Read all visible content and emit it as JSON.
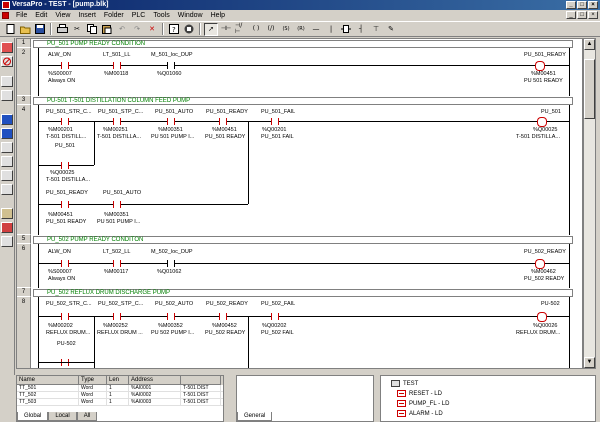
{
  "window": {
    "title": "VersaPro - TEST - [pump.blk]"
  },
  "menu": {
    "items": [
      "File",
      "Edit",
      "View",
      "Insert",
      "Folder",
      "PLC",
      "Tools",
      "Window",
      "Help"
    ]
  },
  "toolbar": {
    "buttons": [
      "new-icon",
      "open-icon",
      "save-icon",
      "print-icon",
      "cut-icon",
      "copy-icon",
      "paste-icon",
      "undo-icon",
      "redo-icon",
      "delete-icon",
      "help-icon",
      "stop-icon",
      "pointer-icon",
      "contact-no-icon",
      "contact-nc-icon",
      "coil-icon",
      "coil-neg-icon",
      "set-coil-icon",
      "reset-coil-icon",
      "horizontal-wire-icon",
      "vertical-wire-icon",
      "function-block-icon",
      "branch-icon",
      "rung-icon",
      "comment-icon"
    ],
    "glyphs": {
      "contact_no": "-| |-",
      "contact_nc": "-|/|-",
      "coil": "( )",
      "coil_neg": "(/)",
      "set": "(S)",
      "reset": "(R)"
    }
  },
  "rungs": [
    {
      "num": "1",
      "comment": "PU_501 PUMP READY CONDITION"
    },
    {
      "num": "2",
      "contacts": [
        {
          "name": "ALW_ON",
          "addr": "%S00007",
          "desc": "Always ON"
        },
        {
          "name": "LT_501_LL",
          "addr": "%M00118",
          "desc": ""
        },
        {
          "name": "M_501_loc_DUP",
          "addr": "%Q01060",
          "desc": ""
        }
      ],
      "coil": {
        "name": "PU_501_READY",
        "addr": "%M00451",
        "desc": "PU 501 READY"
      }
    },
    {
      "num": "3",
      "comment": "PU-501 T-501 DISTILLATION COLUMN FEED PUMP"
    },
    {
      "num": "4",
      "contacts": [
        {
          "name": "PU_501_STR_C...",
          "addr": "%M00201",
          "desc": "T-501 DISTILL..."
        },
        {
          "name": "PU_501_STP_C...",
          "addr": "%M00251",
          "desc": "T-501 DISTILLA..."
        },
        {
          "name": "PU_501_AUTO",
          "addr": "%M00351",
          "desc": "PU 501 PUMP I..."
        },
        {
          "name": "PU_501_READY",
          "addr": "%M00451",
          "desc": "PU_501 READY"
        },
        {
          "name": "PU_501_FAIL",
          "addr": "%Q00201",
          "desc": "PU_501 FAIL"
        }
      ],
      "branch": [
        {
          "name": "PU_501",
          "addr": "%Q00025",
          "desc": "T-501 DISTILLA..."
        },
        {
          "name": "PU_501_READY",
          "addr": "%M00451",
          "desc": "PU_501 READY"
        },
        {
          "name": "PU_501_AUTO",
          "addr": "%M00351",
          "desc": "PU 501 PUMP I..."
        }
      ],
      "coil": {
        "name": "PU_501",
        "addr": "%Q00025",
        "desc": "T-501 DISTILLA..."
      }
    },
    {
      "num": "5",
      "comment": "PU_502 PUMP READY CONDITON"
    },
    {
      "num": "6",
      "contacts": [
        {
          "name": "ALW_ON",
          "addr": "%S00007",
          "desc": "Always ON"
        },
        {
          "name": "LT_502_LL",
          "addr": "%M00117",
          "desc": ""
        },
        {
          "name": "M_502_loc_DUP",
          "addr": "%Q01062",
          "desc": ""
        }
      ],
      "coil": {
        "name": "PU_502_READY",
        "addr": "%M00462",
        "desc": "PU_502 READY"
      }
    },
    {
      "num": "7",
      "comment": "PU_502 REFLUX DRUM DISCHARGE PUMP"
    },
    {
      "num": "8",
      "contacts": [
        {
          "name": "PU_502_STR_C...",
          "addr": "%M00202",
          "desc": "REFLUX DRUM..."
        },
        {
          "name": "PU_502_STP_C...",
          "addr": "%M00252",
          "desc": "REFLUX DRUM ..."
        },
        {
          "name": "PU_502_AUTO",
          "addr": "%M00352",
          "desc": "PU 502 PUMP I..."
        },
        {
          "name": "PU_502_READY",
          "addr": "%M00452",
          "desc": "PU_502 READY"
        },
        {
          "name": "PU_502_FAIL",
          "addr": "%Q00202",
          "desc": "PU_502 FAIL"
        }
      ],
      "branch": [
        {
          "name": "PU-502",
          "addr": "",
          "desc": ""
        }
      ],
      "coil": {
        "name": "PU-502",
        "addr": "%Q00026",
        "desc": "REFLUX DRUM..."
      }
    }
  ],
  "variables": {
    "headers": [
      "Name",
      "Type",
      "Len",
      "Address",
      ""
    ],
    "rows": [
      [
        "TT_501",
        "Word",
        "1",
        "%AI0001",
        "T-501 DIST"
      ],
      [
        "TT_502",
        "Word",
        "1",
        "%AI0002",
        "T-501 DIST"
      ],
      [
        "TT_503",
        "Word",
        "1",
        "%AI0003",
        "T-501 DIST"
      ]
    ],
    "tabs": [
      "Global",
      "Local",
      "All"
    ]
  },
  "info": {
    "tabs": [
      "General"
    ]
  },
  "tree": {
    "items": [
      {
        "label": "TEST",
        "icon": "project-icon"
      },
      {
        "label": "RESET - LD",
        "icon": "ladder-block-icon"
      },
      {
        "label": "PUMP_FL - LD",
        "icon": "ladder-block-icon"
      },
      {
        "label": "ALARM - LD",
        "icon": "ladder-block-icon"
      }
    ]
  },
  "colors": {
    "title_bar": "#0a246a",
    "comment_text": "#008000",
    "contact": "#cc0000",
    "coil": "#cc0000"
  }
}
